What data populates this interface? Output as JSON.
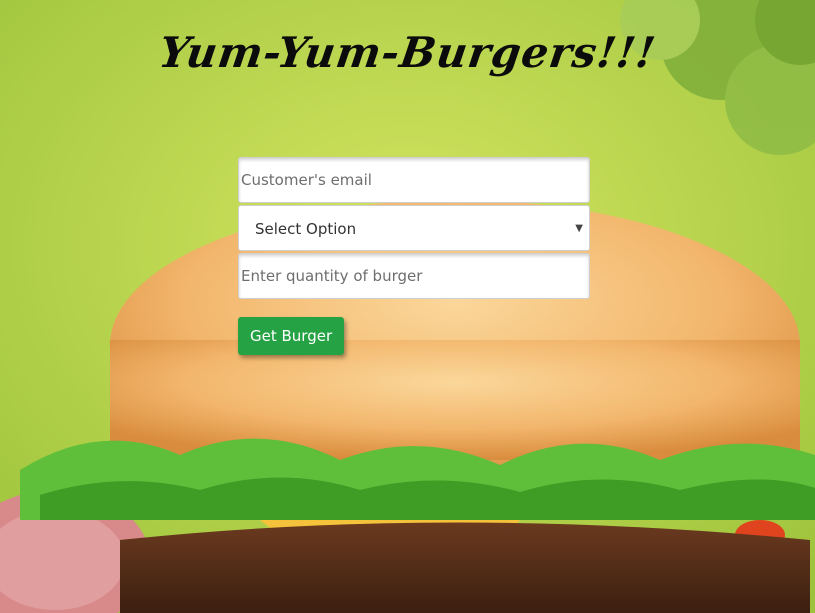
{
  "page": {
    "title": "Yum-Yum-Burgers!!!"
  },
  "form": {
    "email_placeholder": "Customer's email",
    "select_value": "Select Option",
    "quantity_placeholder": "Enter quantity of burger",
    "submit_label": "Get Burger"
  },
  "colors": {
    "background": "#b5d64a",
    "button": "#25a244",
    "title": "#0b0b0b"
  },
  "icons": {
    "select_caret": "chevron-down-icon"
  }
}
